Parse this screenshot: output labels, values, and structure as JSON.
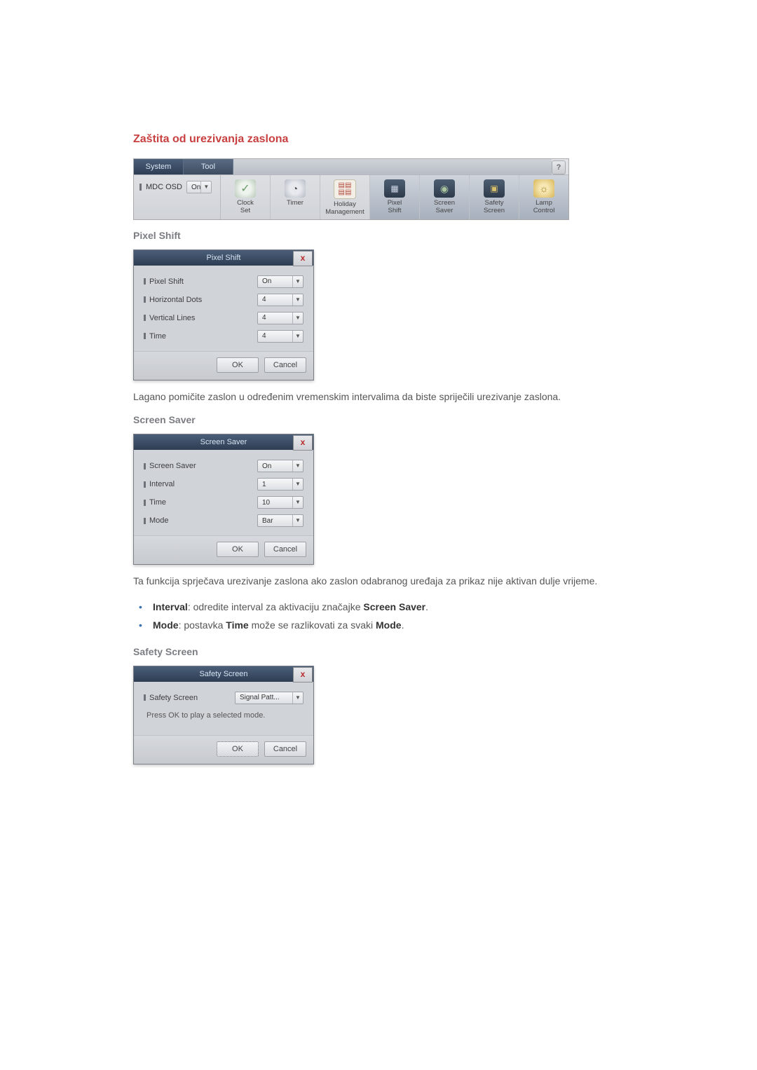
{
  "section_title": "Zaštita od urezivanja zaslona",
  "toolbar": {
    "tab_system": "System",
    "tab_tool": "Tool",
    "help": "?",
    "mdc_osd_label": "MDC OSD",
    "mdc_osd_value": "On",
    "items": [
      {
        "label": "Clock\nSet"
      },
      {
        "label": "Timer"
      },
      {
        "label": "Holiday\nManagement"
      },
      {
        "label": "Pixel\nShift"
      },
      {
        "label": "Screen\nSaver"
      },
      {
        "label": "Safety\nScreen"
      },
      {
        "label": "Lamp\nControl"
      }
    ]
  },
  "pixel_shift": {
    "heading": "Pixel Shift",
    "dialog_title": "Pixel Shift",
    "rows": [
      {
        "label": "Pixel Shift",
        "value": "On"
      },
      {
        "label": "Horizontal Dots",
        "value": "4"
      },
      {
        "label": "Vertical Lines",
        "value": "4"
      },
      {
        "label": "Time",
        "value": "4"
      }
    ],
    "ok": "OK",
    "cancel": "Cancel",
    "body_text": "Lagano pomičite zaslon u određenim vremenskim intervalima da biste spriječili urezivanje zaslona."
  },
  "screen_saver": {
    "heading": "Screen Saver",
    "dialog_title": "Screen Saver",
    "rows": [
      {
        "label": "Screen Saver",
        "value": "On"
      },
      {
        "label": "Interval",
        "value": "1"
      },
      {
        "label": "Time",
        "value": "10"
      },
      {
        "label": "Mode",
        "value": "Bar"
      }
    ],
    "ok": "OK",
    "cancel": "Cancel",
    "body_text": "Ta funkcija sprječava urezivanje zaslona ako zaslon odabranog uređaja za prikaz nije aktivan dulje vrijeme.",
    "bullets": {
      "interval_bold": "Interval",
      "interval_rest": ": odredite interval za aktivaciju značajke ",
      "interval_bold2": "Screen Saver",
      "interval_tail": ".",
      "mode_bold": "Mode",
      "mode_rest": ": postavka ",
      "mode_bold2": "Time",
      "mode_rest2": " može se razlikovati za svaki ",
      "mode_bold3": "Mode",
      "mode_tail": "."
    }
  },
  "safety_screen": {
    "heading": "Safety Screen",
    "dialog_title": "Safety Screen",
    "row_label": "Safety Screen",
    "row_value": "Signal Patt...",
    "hint": "Press OK to play a selected mode.",
    "ok": "OK",
    "cancel": "Cancel"
  }
}
